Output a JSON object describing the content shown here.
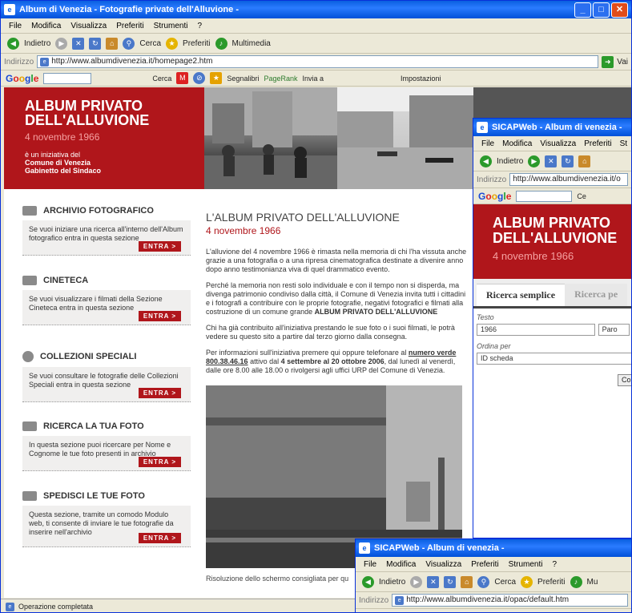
{
  "main_window": {
    "title": "Album di Venezia - Fotografie private dell'Alluvione -",
    "menu": [
      "File",
      "Modifica",
      "Visualizza",
      "Preferiti",
      "Strumenti",
      "?"
    ],
    "toolbar": {
      "back": "Indietro",
      "search": "Cerca",
      "favorites": "Preferiti",
      "multimedia": "Multimedia"
    },
    "address_label": "Indirizzo",
    "address": "http://www.albumdivenezia.it/homepage2.htm",
    "go_label": "Vai",
    "google": {
      "search_label": "Cerca",
      "bookmarks": "Segnalibri",
      "pagerank": "PageRank",
      "send": "Invia a",
      "settings": "Impostazioni"
    },
    "status": "Operazione completata"
  },
  "site": {
    "header_title_1": "ALBUM PRIVATO",
    "header_title_2": "DELL'ALLUVIONE",
    "header_date": "4 novembre 1966",
    "initiative_1": "è un iniziativa del",
    "initiative_2": "Comune di Venezia",
    "initiative_3": "Gabinetto del Sindaco",
    "sections": [
      {
        "title": "ARCHIVIO FOTOGRAFICO",
        "text": "Se vuoi iniziare una ricerca all'interno dell'Album fotografico entra in questa sezione",
        "button": "ENTRA >"
      },
      {
        "title": "CINETECA",
        "text": "Se vuoi visualizzare i filmati della Sezione Cineteca entra in questa sezione",
        "button": "ENTRA >"
      },
      {
        "title": "COLLEZIONI SPECIALI",
        "text": "Se vuoi consultare le fotografie delle Collezioni Speciali entra in questa sezione",
        "button": "ENTRA >"
      },
      {
        "title": "RICERCA LA TUA FOTO",
        "text": "In questa sezione puoi ricercare per Nome e Cognome le tue foto presenti in archivio",
        "button": "ENTRA >"
      },
      {
        "title": "SPEDISCI LE TUE FOTO",
        "text": "Questa sezione, tramite un comodo Modulo web, ti consente di inviare le tue fotografie da inserire nell'archivio",
        "button": "ENTRA >"
      }
    ],
    "main_title": "L'ALBUM PRIVATO DELL'ALLUVIONE",
    "main_date": "4 novembre 1966",
    "para1": "L'alluvione del 4 novembre 1966 è rimasta nella memoria di chi l'ha vissuta anche grazie a una fotografia o a una ripresa cinematografica destinate a divenire anno dopo anno testimonianza viva di quel drammatico evento.",
    "para2a": "Perché la memoria non resti solo individuale e con il tempo non si disperda, ma divenga patrimonio condiviso dalla città, il Comune di Venezia invita tutti i cittadini e i fotografi a contribuire con le proprie fotografie, negativi fotografici e filmati alla costruzione di un comune grande ",
    "para2b": "ALBUM PRIVATO DELL'ALLUVIONE",
    "para3": "Chi ha già contribuito all'iniziativa prestando le sue foto o i suoi filmati, le potrà vedere su questo sito a partire dal terzo giorno dalla consegna.",
    "para4a": "Per informazioni sull'iniziativa premere qui oppure telefonare al ",
    "para4b": "numero verde 800.38.46.16",
    "para4c": " attivo dal ",
    "para4d": "4 settembre al 20 ottobre 2006",
    "para4e": ", dal lunedì al venerdì, dalle ore 8.00 alle 18.00 o rivolgersi agli uffici URP del Comune di Venezia.",
    "resolution": "Risoluzione dello schermo consigliata per qu"
  },
  "popup1": {
    "title": "SICAPWeb - Album di venezia -",
    "menu": [
      "File",
      "Modifica",
      "Visualizza",
      "Preferiti",
      "St"
    ],
    "back": "Indietro",
    "address_label": "Indirizzo",
    "address": "http://www.albumdivenezia.it/o",
    "google_search": "Ce",
    "header_title_1": "ALBUM PRIVATO",
    "header_title_2": "DELL'ALLUVIONE",
    "header_date": "4 novembre 1966",
    "tab_simple": "Ricerca semplice",
    "tab_advanced": "Ricerca pe",
    "testo_label": "Testo",
    "testo_value": "1966",
    "parole_value": "Paro",
    "ordina_label": "Ordina per",
    "ordina_value": "ID scheda",
    "button": "Con"
  },
  "popup2": {
    "title": "SICAPWeb - Album di venezia -",
    "menu": [
      "File",
      "Modifica",
      "Visualizza",
      "Preferiti",
      "Strumenti",
      "?"
    ],
    "toolbar": {
      "back": "Indietro",
      "search": "Cerca",
      "favorites": "Preferiti",
      "multimedia": "Mu"
    },
    "address_label": "Indirizzo",
    "address": "http://www.albumdivenezia.it/opac/default.htm"
  }
}
